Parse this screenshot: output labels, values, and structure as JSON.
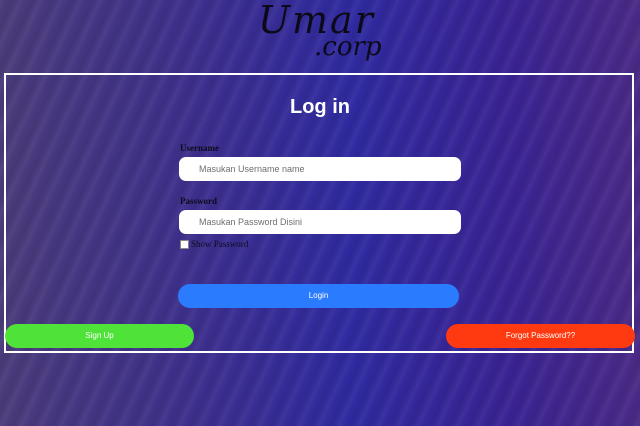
{
  "logo": {
    "line1": "Umar",
    "line2": ".corp"
  },
  "form": {
    "title": "Log in",
    "username_label": "Username",
    "username_placeholder": "Masukan Username name",
    "password_label": "Password",
    "password_placeholder": "Masukan Password Disini",
    "show_password_label": "Show Password",
    "login_label": "Login"
  },
  "actions": {
    "signup_label": "Sign Up",
    "forgot_label": "Forgot Password??"
  },
  "colors": {
    "login": "#2b7bff",
    "signup": "#4fe33a",
    "forgot": "#ff3a10"
  }
}
